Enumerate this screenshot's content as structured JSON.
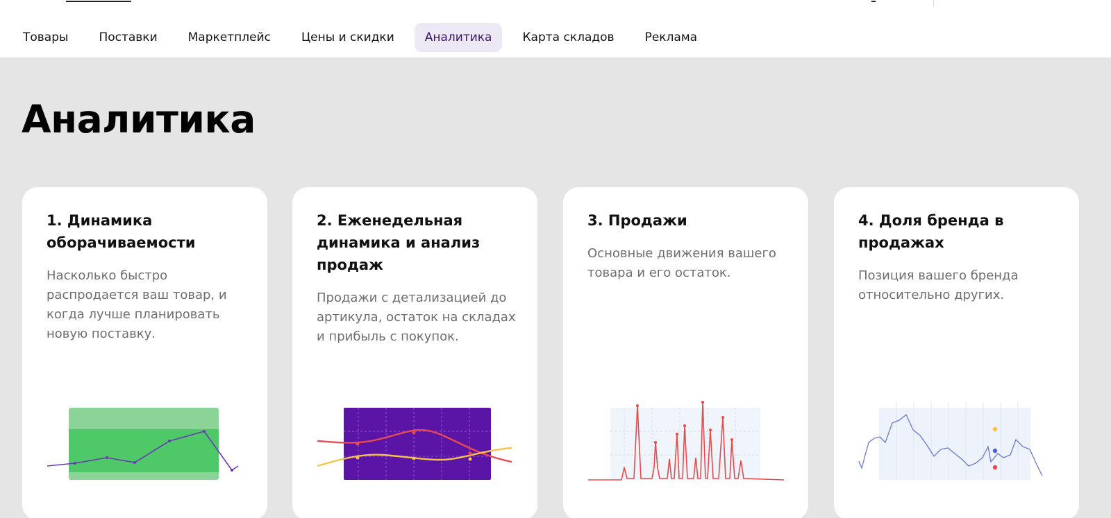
{
  "nav": {
    "items": [
      {
        "label": "Товары"
      },
      {
        "label": "Поставки"
      },
      {
        "label": "Маркетплейс"
      },
      {
        "label": "Цены и скидки"
      },
      {
        "label": "Аналитика",
        "active": true
      },
      {
        "label": "Карта складов"
      },
      {
        "label": "Реклама"
      }
    ],
    "active_color": "#3a1466",
    "active_bg": "#ede9f4"
  },
  "page": {
    "title": "Аналитика"
  },
  "cards": [
    {
      "title": "1. Динамика оборачиваемости",
      "desc": "Насколько быстро распродается ваш товар, и когда лучше планировать новую поставку.",
      "illustration": "turnover-chart",
      "accent": "#4fc868"
    },
    {
      "title": "2. Еженедельная динамика и анализ продаж",
      "desc": "Продажи с детализацией до артикула, остаток на складах и прибыль с покупок.",
      "illustration": "weekly-sales-chart",
      "accent": "#5a14a6"
    },
    {
      "title": "3. Продажи",
      "desc": "Основные движения вашего товара и его остаток.",
      "illustration": "sales-spikes-chart",
      "accent": "#e84a4a"
    },
    {
      "title": "4. Доля бренда в продажах",
      "desc": "Позиция вашего бренда относительно других.",
      "illustration": "brand-share-chart",
      "accent": "#5b6bd6"
    }
  ]
}
